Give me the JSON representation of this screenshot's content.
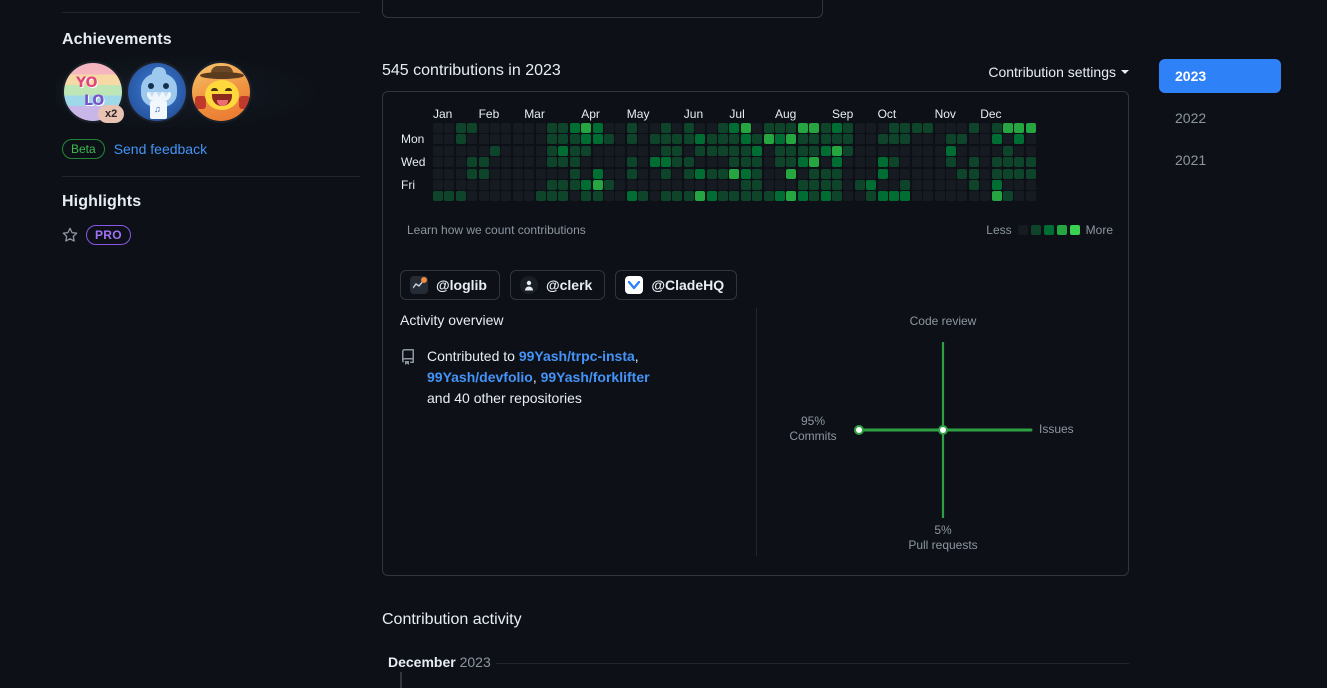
{
  "sidebar": {
    "achievements_heading": "Achievements",
    "badges": [
      {
        "name": "yolo",
        "line1": "YO",
        "line2": "LO",
        "multiplier": ""
      },
      {
        "name": "pull-shark",
        "line1": "",
        "line2": "",
        "multiplier": "x2"
      },
      {
        "name": "starstruck",
        "line1": "",
        "line2": "",
        "multiplier": ""
      }
    ],
    "beta_label": "Beta",
    "feedback_link": "Send feedback",
    "highlights_heading": "Highlights",
    "pro_label": "PRO",
    "star_icon": "star-icon"
  },
  "contributions": {
    "title": "545 contributions in 2023",
    "settings_label": "Contribution settings",
    "count_link": "Learn how we count contributions",
    "legend_less": "Less",
    "legend_more": "More",
    "day_labels": [
      "Mon",
      "Wed",
      "Fri"
    ],
    "months": [
      "Jan",
      "Feb",
      "Mar",
      "Apr",
      "May",
      "Jun",
      "Jul",
      "Aug",
      "Sep",
      "Oct",
      "Nov",
      "Dec"
    ],
    "levels": [
      "#161b22",
      "#0e4429",
      "#006d32",
      "#26a641",
      "#39d353"
    ]
  },
  "years": [
    {
      "label": "2023",
      "active": true
    },
    {
      "label": "2022",
      "active": false
    },
    {
      "label": "2021",
      "active": false
    }
  ],
  "organizations": [
    {
      "handle": "@loglib",
      "icon": "chart-icon"
    },
    {
      "handle": "@clerk",
      "icon": "clerk-icon"
    },
    {
      "handle": "@CladeHQ",
      "icon": "clade-icon"
    }
  ],
  "activity_overview": {
    "title": "Activity overview",
    "icon": "repo-icon",
    "prefix": "Contributed to ",
    "repos": [
      "99Yash/trpc-insta",
      "99Yash/devfolio",
      "99Yash/forklifter"
    ],
    "suffix": "and 40 other repositories"
  },
  "contribution_activity": {
    "title": "Contribution activity",
    "month": "December",
    "year": "2023"
  },
  "colors": {
    "accent_blue": "#2f81f7",
    "link_blue": "#4493f8",
    "green": "#3fb950",
    "purple": "#a371f7",
    "radar_green": "#2ea043"
  },
  "chart_data": {
    "type": "radar",
    "title": "Activity overview",
    "categories": [
      "Code review",
      "Issues",
      "Pull requests",
      "Commits"
    ],
    "values": [
      0,
      0,
      5,
      95
    ],
    "labels": [
      "Code review",
      "Issues",
      "5%\nPull requests",
      "95%\nCommits"
    ],
    "value_labels": [
      "",
      "",
      "5%",
      "95%"
    ],
    "unit": "%",
    "axis_max": 100,
    "grid": false,
    "legend": "none"
  },
  "calendar_data": {
    "type": "heatmap",
    "weeks": 53,
    "days_per_week": 7,
    "total": 545,
    "year": "2023",
    "levels_scale": [
      0,
      1,
      2,
      3,
      4
    ],
    "grid": [
      [
        0,
        0,
        0,
        0,
        0,
        0,
        1
      ],
      [
        0,
        0,
        0,
        0,
        0,
        0,
        1
      ],
      [
        1,
        1,
        0,
        0,
        0,
        0,
        1
      ],
      [
        1,
        0,
        0,
        1,
        1,
        0,
        0
      ],
      [
        0,
        0,
        0,
        1,
        1,
        0,
        0
      ],
      [
        0,
        0,
        1,
        0,
        0,
        0,
        0
      ],
      [
        0,
        0,
        0,
        0,
        0,
        0,
        0
      ],
      [
        0,
        0,
        0,
        0,
        0,
        0,
        0
      ],
      [
        0,
        0,
        0,
        0,
        0,
        0,
        0
      ],
      [
        0,
        0,
        0,
        0,
        0,
        0,
        1
      ],
      [
        1,
        1,
        1,
        1,
        0,
        1,
        1
      ],
      [
        1,
        1,
        2,
        1,
        0,
        1,
        1
      ],
      [
        2,
        1,
        1,
        1,
        1,
        1,
        0
      ],
      [
        3,
        2,
        1,
        0,
        0,
        2,
        1
      ],
      [
        2,
        2,
        0,
        0,
        2,
        3,
        1
      ],
      [
        0,
        1,
        0,
        0,
        0,
        1,
        0
      ],
      [
        0,
        0,
        0,
        0,
        0,
        0,
        0
      ],
      [
        1,
        1,
        0,
        1,
        1,
        0,
        2
      ],
      [
        0,
        0,
        0,
        0,
        0,
        0,
        1
      ],
      [
        0,
        1,
        0,
        2,
        0,
        0,
        0
      ],
      [
        1,
        1,
        1,
        2,
        1,
        0,
        1
      ],
      [
        0,
        1,
        1,
        1,
        0,
        0,
        1
      ],
      [
        1,
        1,
        0,
        1,
        1,
        0,
        1
      ],
      [
        0,
        2,
        1,
        0,
        2,
        0,
        3
      ],
      [
        0,
        1,
        1,
        0,
        1,
        0,
        2
      ],
      [
        1,
        1,
        1,
        0,
        1,
        0,
        1
      ],
      [
        2,
        1,
        1,
        1,
        3,
        0,
        1
      ],
      [
        3,
        2,
        1,
        1,
        2,
        1,
        1
      ],
      [
        0,
        1,
        2,
        1,
        1,
        1,
        1
      ],
      [
        1,
        3,
        0,
        0,
        0,
        0,
        1
      ],
      [
        1,
        2,
        1,
        1,
        0,
        0,
        2
      ],
      [
        1,
        3,
        1,
        1,
        3,
        0,
        3
      ],
      [
        3,
        1,
        1,
        2,
        0,
        1,
        2
      ],
      [
        3,
        1,
        1,
        3,
        1,
        1,
        1
      ],
      [
        1,
        1,
        2,
        0,
        1,
        1,
        2
      ],
      [
        2,
        1,
        3,
        2,
        1,
        1,
        1
      ],
      [
        1,
        1,
        1,
        0,
        0,
        0,
        0
      ],
      [
        0,
        0,
        0,
        0,
        0,
        1,
        0
      ],
      [
        0,
        0,
        0,
        0,
        0,
        2,
        1
      ],
      [
        0,
        1,
        0,
        2,
        2,
        0,
        2
      ],
      [
        1,
        1,
        0,
        1,
        0,
        0,
        2
      ],
      [
        1,
        1,
        0,
        0,
        0,
        1,
        2
      ],
      [
        1,
        0,
        0,
        0,
        0,
        0,
        0
      ],
      [
        1,
        0,
        0,
        0,
        0,
        0,
        0
      ],
      [
        0,
        0,
        0,
        0,
        0,
        0,
        0
      ],
      [
        0,
        1,
        2,
        1,
        0,
        0,
        0
      ],
      [
        0,
        1,
        0,
        0,
        1,
        0,
        0
      ],
      [
        1,
        0,
        0,
        1,
        1,
        1,
        0
      ],
      [
        0,
        0,
        0,
        0,
        0,
        0,
        0
      ],
      [
        1,
        2,
        0,
        1,
        1,
        2,
        3
      ],
      [
        3,
        0,
        1,
        1,
        1,
        0,
        1
      ],
      [
        3,
        2,
        0,
        1,
        1,
        0,
        0
      ],
      [
        3,
        0,
        0,
        1,
        1,
        0,
        0
      ]
    ]
  }
}
